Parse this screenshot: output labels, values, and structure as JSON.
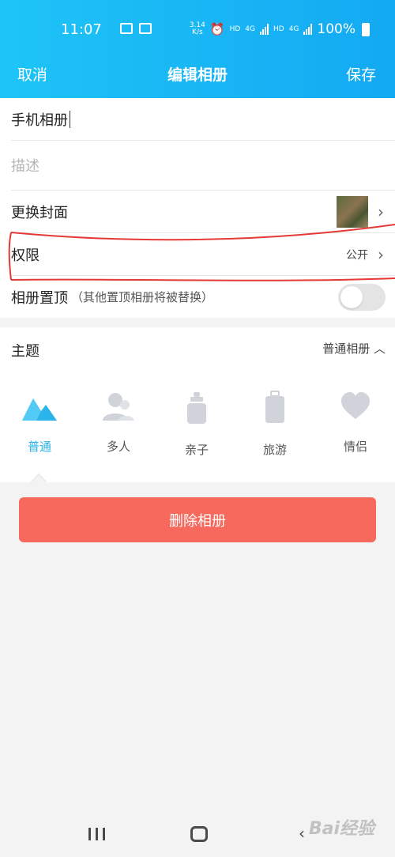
{
  "status_bar": {
    "time": "11:07",
    "net_speed_top": "3.14",
    "net_speed_bottom": "K/s",
    "hd1": "HD",
    "net1": "4G",
    "hd2": "HD",
    "net2": "4G",
    "battery": "100%"
  },
  "nav": {
    "cancel_label": "取消",
    "title": "编辑相册",
    "save_label": "保存"
  },
  "form": {
    "name_value": "手机相册",
    "description_placeholder": "描述",
    "cover_label": "更换封面",
    "permission_label": "权限",
    "permission_value": "公开",
    "pin_label": "相册置顶",
    "pin_hint": "（其他置顶相册将被替换）",
    "pin_enabled": false
  },
  "theme": {
    "title": "主题",
    "selected": "普通相册",
    "items": [
      {
        "label": "普通",
        "icon": "mountain-icon",
        "active": true
      },
      {
        "label": "多人",
        "icon": "people-icon",
        "active": false
      },
      {
        "label": "亲子",
        "icon": "baby-bottle-icon",
        "active": false
      },
      {
        "label": "旅游",
        "icon": "suitcase-icon",
        "active": false
      },
      {
        "label": "情侣",
        "icon": "heart-icon",
        "active": false
      }
    ]
  },
  "delete_label": "删除相册",
  "watermark": "Bai经验",
  "colors": {
    "header_start": "#1ec4f7",
    "header_end": "#13a9f2",
    "accent": "#2ab4ea",
    "delete": "#f7695c",
    "annotation": "#e53935"
  }
}
